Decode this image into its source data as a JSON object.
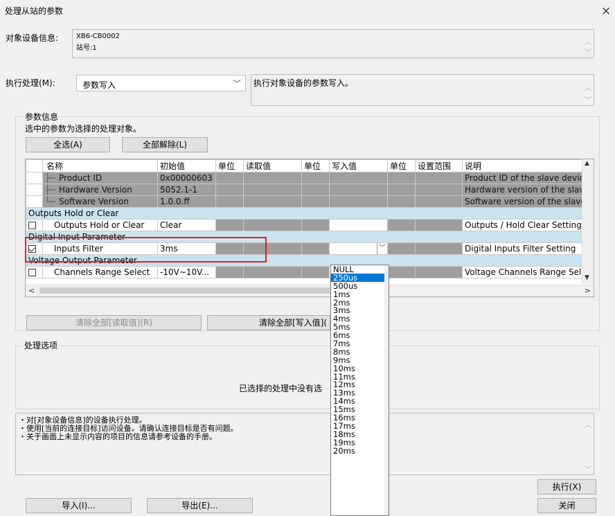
{
  "window": {
    "title": "处理从站的参数",
    "close_glyph": "×"
  },
  "target": {
    "label": "对象设备信息:",
    "lines": [
      "XB6-CB0002",
      "站号:1"
    ]
  },
  "process": {
    "label": "执行处理(M):",
    "selected": "参数写入",
    "description": "执行对象设备的参数写入。"
  },
  "param_info": {
    "title": "参数信息",
    "hint": "选中的参数为选择的处理对象。",
    "select_all": "全选(A)",
    "deselect_all": "全部解除(L)"
  },
  "table": {
    "headers": [
      "名称",
      "初始值",
      "单位",
      "读取值",
      "单位",
      "写入值",
      "单位",
      "设置范围",
      "说明"
    ],
    "rows": [
      {
        "kind": "gray",
        "name": "Product ID",
        "init": "0x00000603",
        "desc": "Product ID of the slave device"
      },
      {
        "kind": "gray",
        "name": "Hardware Version",
        "init": "5052.1-1",
        "desc": "Hardware version of the slave d"
      },
      {
        "kind": "gray",
        "name": "Software Version",
        "init": "1.0.0.ff",
        "desc": "Software version of the slave d"
      },
      {
        "kind": "section",
        "name": "Outputs Hold or Clear"
      },
      {
        "kind": "plain",
        "name": "Outputs Hold or Clear",
        "init": "Clear",
        "desc": "Outputs / Hold Clear Setting",
        "checked": false
      },
      {
        "kind": "section",
        "name": "Digital Input Parameter"
      },
      {
        "kind": "plain",
        "name": "Inputs Filter",
        "init": "3ms",
        "desc": "Digital Inputs Filter Setting",
        "checked": true
      },
      {
        "kind": "section",
        "name": "Voltage Output Parameter"
      },
      {
        "kind": "plain",
        "name": "Channels Range Select",
        "init": "-10V~10V...",
        "desc": "Voltage Channels Range Select",
        "checked": false
      }
    ]
  },
  "dropdown_options": [
    "NULL",
    "250us",
    "500us",
    "1ms",
    "2ms",
    "3ms",
    "4ms",
    "5ms",
    "6ms",
    "7ms",
    "8ms",
    "9ms",
    "10ms",
    "11ms",
    "12ms",
    "13ms",
    "14ms",
    "15ms",
    "16ms",
    "17ms",
    "18ms",
    "19ms",
    "20ms"
  ],
  "dropdown_selected": "250us",
  "clear_read": "清除全部[读取值](R)",
  "clear_write": "清除全部[写入值](",
  "options": {
    "title": "处理选项",
    "message": "已选择的处理中没有选"
  },
  "notes": [
    "・对[对象设备信息]的设备执行处理。",
    "・使用[当前的连接目标]访问设备。请确认连接目标是否有问题。",
    "・关于画面上未显示内容的项目的信息请参考设备的手册。"
  ],
  "buttons": {
    "execute": "执行(X)",
    "import": "导入(I)...",
    "export": "导出(E)...",
    "close": "关闭"
  },
  "colors": {
    "highlight_box": "#e02020",
    "selected_option": "#0078d7",
    "section_row": "#cbe3ee"
  }
}
